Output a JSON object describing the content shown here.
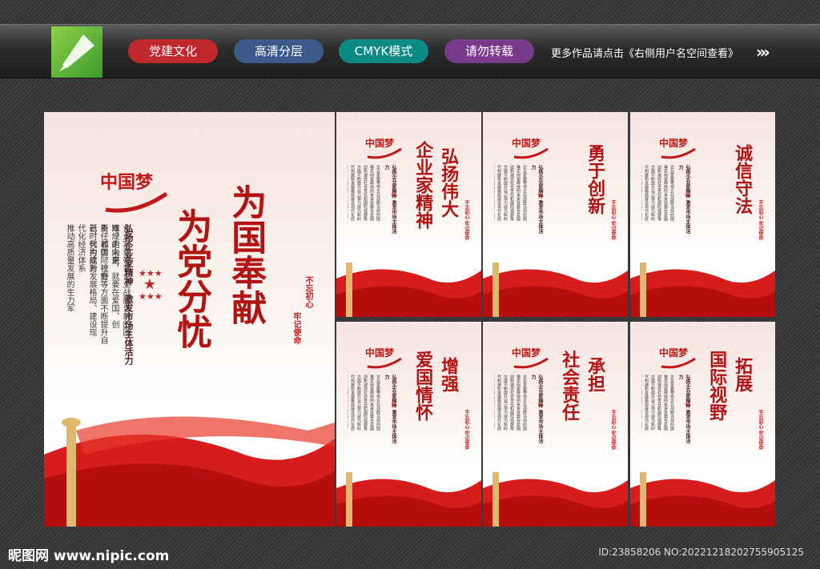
{
  "header": {
    "tags": [
      {
        "label": "党建文化",
        "color": "#c0282d"
      },
      {
        "label": "高清分层",
        "color": "#3b5a8a"
      },
      {
        "label": "CMYK模式",
        "color": "#0b8a85"
      },
      {
        "label": "请勿转载",
        "color": "#7a3a8c"
      }
    ],
    "promo": "更多作品请点击《右侧用户名空间查看》",
    "arrows": "»»"
  },
  "main_poster": {
    "logo_text": "中国梦",
    "slogan_lines": [
      "为国奉献",
      "为党分忧"
    ],
    "subtitle_lines": [
      "弘扬企业家精神　激发市场主体活力"
    ],
    "body_lines": [
      "企业家要带领企业战胜当前的困难，走向更",
      "辉煌的未来，就要在爱国、创新、诚信、社会",
      "责任和国际视野等方面不断提升自己，努力成为",
      "新时代构建新发展格局、建设现代化经济体系",
      "推动高质量发展的生力军"
    ],
    "seal_lines": [
      "不忘初心",
      "牢记使命"
    ],
    "stars": "★★★★★"
  },
  "small_posters": [
    {
      "slogan_lines": [
        "弘扬伟大",
        "企业家精神"
      ],
      "seal": "不忘初心 牢记使命"
    },
    {
      "slogan_lines": [
        "勇于创新"
      ],
      "seal": "不忘初心 牢记使命"
    },
    {
      "slogan_lines": [
        "诚信守法"
      ],
      "seal": "不忘初心 牢记使命"
    },
    {
      "slogan_lines": [
        "增强",
        "爱国情怀"
      ],
      "seal": "不忘初心 牢记使命"
    },
    {
      "slogan_lines": [
        "承担",
        "社会责任"
      ],
      "seal": "不忘初心 牢记使命"
    },
    {
      "slogan_lines": [
        "拓展",
        "国际视野"
      ],
      "seal": "不忘初心 牢记使命"
    }
  ],
  "small_subtitle": "弘扬企业家精神 激发市场主体活力",
  "small_body": "企业家要带领企业战胜当前的困难走向更辉煌的未来就要在爱国创新诚信社会责任和国际视野等方面不断提升自己努力成为新时代构建新发展格局建设现代化经济体系推动高质量发展的生力军",
  "footer": {
    "site": "昵图网 www.nipic.com",
    "id": "ID:23858206 NO:20221218202755905125"
  }
}
